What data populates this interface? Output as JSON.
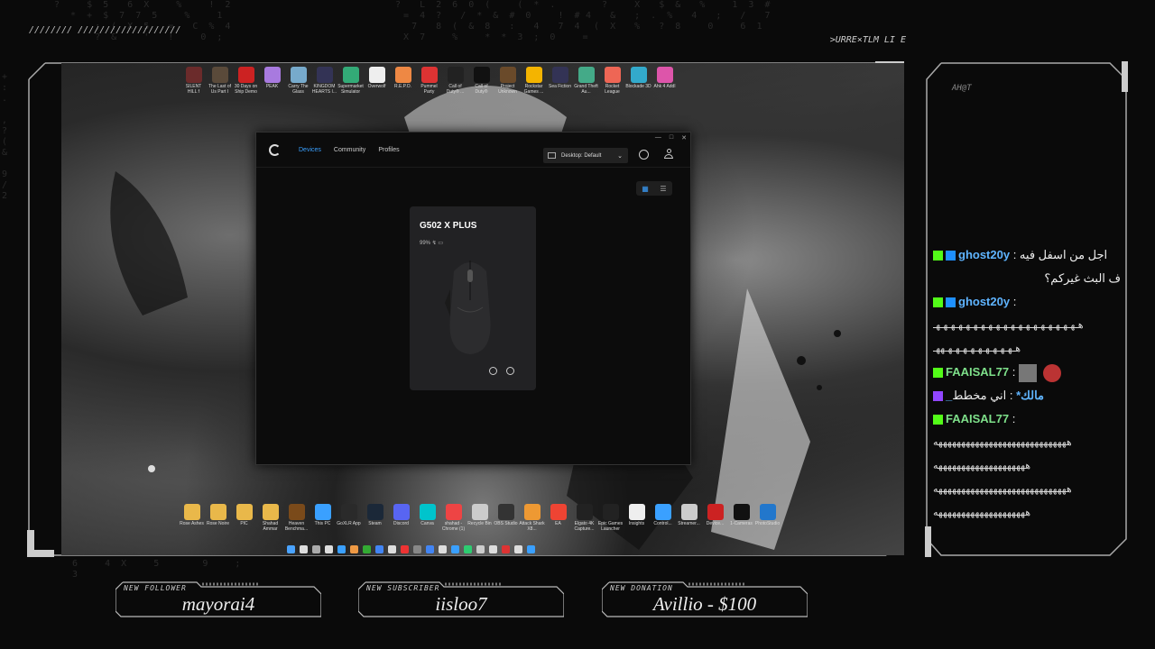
{
  "overlay": {
    "top_left_marks": "////////\n///////////////////",
    "top_right_text": ">URRE×TLM LI E",
    "chat_corner_text": "AH@T"
  },
  "desktop": {
    "top_icons": [
      {
        "label": "SILENT HILL f",
        "color": "#6b2b2b"
      },
      {
        "label": "The Last of Us Part I",
        "color": "#5a4a3a"
      },
      {
        "label": "30 Days on Ship Demo",
        "color": "#c22"
      },
      {
        "label": "PEAK",
        "color": "#a87adf"
      },
      {
        "label": "Carry The Glass",
        "color": "#7ac"
      },
      {
        "label": "KINGDOM HEARTS I...",
        "color": "#335"
      },
      {
        "label": "Supermarket Simulator",
        "color": "#3a7"
      },
      {
        "label": "Overwolf",
        "color": "#eee"
      },
      {
        "label": "R.E.P.O.",
        "color": "#e84"
      },
      {
        "label": "Pummel Party",
        "color": "#d33"
      },
      {
        "label": "Call of Duty® ...",
        "color": "#222"
      },
      {
        "label": "Call of Duty®",
        "color": "#111"
      },
      {
        "label": "Project Unknown",
        "color": "#6a4a2a"
      },
      {
        "label": "Rockstar Games ...",
        "color": "#f4b400"
      },
      {
        "label": "Sea Fiction",
        "color": "#335"
      },
      {
        "label": "Grand Theft Au...",
        "color": "#4a8"
      },
      {
        "label": "Rocket League",
        "color": "#e65"
      },
      {
        "label": "Blockade 3D",
        "color": "#3ac"
      },
      {
        "label": "Ahk 4 Addl",
        "color": "#d5a"
      }
    ],
    "bottom_icons": [
      {
        "label": "Rose Ashes",
        "color": "#e9b84a"
      },
      {
        "label": "Rose Noire",
        "color": "#e9b84a"
      },
      {
        "label": "PIC",
        "color": "#e9b84a"
      },
      {
        "label": "Shahad Ammar",
        "color": "#e9b84a"
      },
      {
        "label": "Heaven Benchma...",
        "color": "#7a4a1a"
      },
      {
        "label": "This PC",
        "color": "#3aa0ff"
      },
      {
        "label": "GoXLR App",
        "color": "#2a2a2a"
      },
      {
        "label": "Steam",
        "color": "#1b2838"
      },
      {
        "label": "Discord",
        "color": "#5865f2"
      },
      {
        "label": "Canva",
        "color": "#00c4cc"
      },
      {
        "label": "shahad - Chrome (1)",
        "color": "#e44"
      },
      {
        "label": "Recycle Bin",
        "color": "#ccc"
      },
      {
        "label": "OBS Studio",
        "color": "#333"
      },
      {
        "label": "Attack Shark X8...",
        "color": "#e93"
      },
      {
        "label": "EA",
        "color": "#e43"
      },
      {
        "label": "Elgato 4K Capture...",
        "color": "#222"
      },
      {
        "label": "Epic Games Launcher",
        "color": "#222"
      },
      {
        "label": "Insights",
        "color": "#eee"
      },
      {
        "label": "Control...",
        "color": "#3aa0ff"
      },
      {
        "label": "Streamer...",
        "color": "#ccc"
      },
      {
        "label": "Device...",
        "color": "#c22"
      },
      {
        "label": "1-Cameras",
        "color": "#111"
      },
      {
        "label": "PhotoStudio",
        "color": "#27c"
      }
    ],
    "taskbar_colors": [
      "#4aa3ff",
      "#ddd",
      "#aaa",
      "#ddd",
      "#3aa0ff",
      "#e94",
      "#3a3",
      "#4285f4",
      "#ddd",
      "#e33",
      "#888",
      "#4285f4",
      "#ddd",
      "#3aa0ff",
      "#2ecc71",
      "#ccc",
      "#ddd",
      "#d33",
      "#ddd",
      "#3aa0ff"
    ]
  },
  "app": {
    "nav": {
      "devices": "Devices",
      "community": "Community",
      "profiles": "Profiles"
    },
    "profile_selector": "Desktop: Default",
    "window_controls": {
      "minimize": "—",
      "maximize": "□",
      "close": "✕"
    },
    "device": {
      "name": "G502 X PLUS",
      "battery": "99%"
    }
  },
  "chat": {
    "messages": [
      {
        "user": "ghost20y",
        "user_color": "blue",
        "text": " : اجل من اسفل فيه",
        "cont": "ف البث غيركم؟"
      },
      {
        "user": "ghost20y",
        "user_color": "blue",
        "text": " :",
        "cont": "هـهـهـهـهـهـهـهـهـهـهـهـهـهـهـهـهـهـهـهـ",
        "cont2": "هـهـهـهـهـهـهـهـهـهـههـ"
      },
      {
        "user": "FAAISAL77",
        "user_color": "green",
        "text": " :",
        "cont": ""
      },
      {
        "user": "_مالك*",
        "user_color": "blue",
        "text": " : اني مخطط",
        "cont": ""
      },
      {
        "user": "FAAISAL77",
        "user_color": "green",
        "text": " :",
        "cont": "هههههههههههههههههههههههههههههه",
        "cont2": "ههههههههههههههههههههه",
        "cont3": "هههههههههههههههههههههههههههههه",
        "cont4": "ههههههههههههههههههههه"
      }
    ]
  },
  "alerts": {
    "follower": {
      "label": "NEW FOLLOWER",
      "value": "mayorai4"
    },
    "subscriber": {
      "label": "NEW SUBSCRIBER",
      "value": "iisloo7"
    },
    "donation": {
      "label": "NEW DONATION",
      "value": "Avillio - $100"
    }
  }
}
